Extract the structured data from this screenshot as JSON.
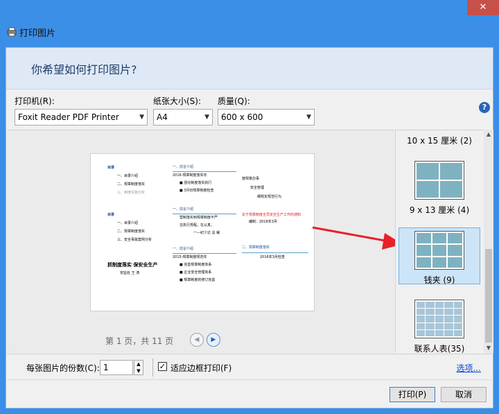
{
  "window": {
    "title": "打印图片",
    "close_glyph": "✕"
  },
  "banner": {
    "heading": "你希望如何打印图片?"
  },
  "settings": {
    "printer_label": "打印机(R):",
    "printer_value": "Foxit Reader PDF Printer",
    "paper_label": "纸张大小(S):",
    "paper_value": "A4",
    "quality_label": "质量(Q):",
    "quality_value": "600 x 600"
  },
  "preview": {
    "page_info": "第 1 页，共 11 页",
    "sheet": {
      "col1": [
        "目录",
        "一、目录介绍",
        "二、规章制度落实",
        "三、制度实施分析",
        "目录",
        "一、目录介绍",
        "二、规章制度落实",
        "三、安全事故案例分析",
        "抓制度落实  保安全生产",
        "安监处  王  涛"
      ],
      "col2": [
        "一、前言介绍",
        "2016-规章制度落实年",
        "■ 强化制度落实执行",
        "■ 3月份规章制度检查",
        "一、前言介绍",
        "营制落实到规章制度不严",
        "在执行规程，在认真，",
        "一—纪少达  总  裁",
        "一、前言介绍",
        "2015-规章制度规范年",
        "■ 完善规章制度体系",
        "■ 企业安全管理体系",
        "■ 规章制度的修订完善"
      ],
      "col3": [
        "按规章办事",
        "安全管理",
        "细规定规范行为",
        "关于规章制度全员安全生产工作的通知",
        "编制：2016年3月",
        "二、规章制度落实",
        "2016年3月检查"
      ]
    }
  },
  "layouts": [
    {
      "label": "10 x 15 厘米 (2)"
    },
    {
      "label": "9 x 13 厘米 (4)"
    },
    {
      "label": "钱夹 (9)"
    },
    {
      "label": "联系人表(35)"
    }
  ],
  "copies": {
    "label": "每张图片的份数(C):",
    "value": "1",
    "fit_label": "适应边框打印(F)",
    "fit_checked": "✓"
  },
  "links": {
    "options": "选项..."
  },
  "buttons": {
    "print": "打印(P)",
    "cancel": "取消"
  },
  "colors": {
    "accent": "#3c8fe6",
    "selected_bg": "#cce4f7",
    "arrow": "#e8202a"
  }
}
